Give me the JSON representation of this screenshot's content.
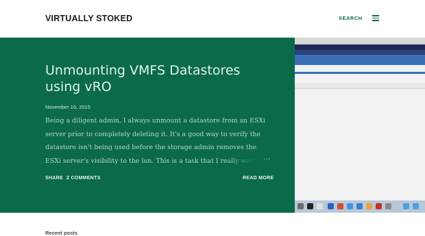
{
  "header": {
    "site_title": "VIRTUALLY STOKED",
    "search_label": "SEARCH",
    "menu_icon": "hamburger-menu-icon"
  },
  "post": {
    "title": "Unmounting VMFS Datastores using vRO",
    "date": "November 16, 2015",
    "snippet": "Being a diligent admin, I always unmount a datastore from an ESXi server prior to completely deleting it.  It's a good way to verify the datastore isn't being used before the storage admin removes the ESXi server's visibility to the lun.  This is a task that I really want to perform",
    "ellipsis": "…",
    "share_label": "SHARE",
    "comments_label": "2 COMMENTS",
    "read_more_label": "READ MORE"
  },
  "recent_label": "Recent posts",
  "colors": {
    "accent": "#0b6a4a",
    "title_text": "#1b1b1b"
  }
}
